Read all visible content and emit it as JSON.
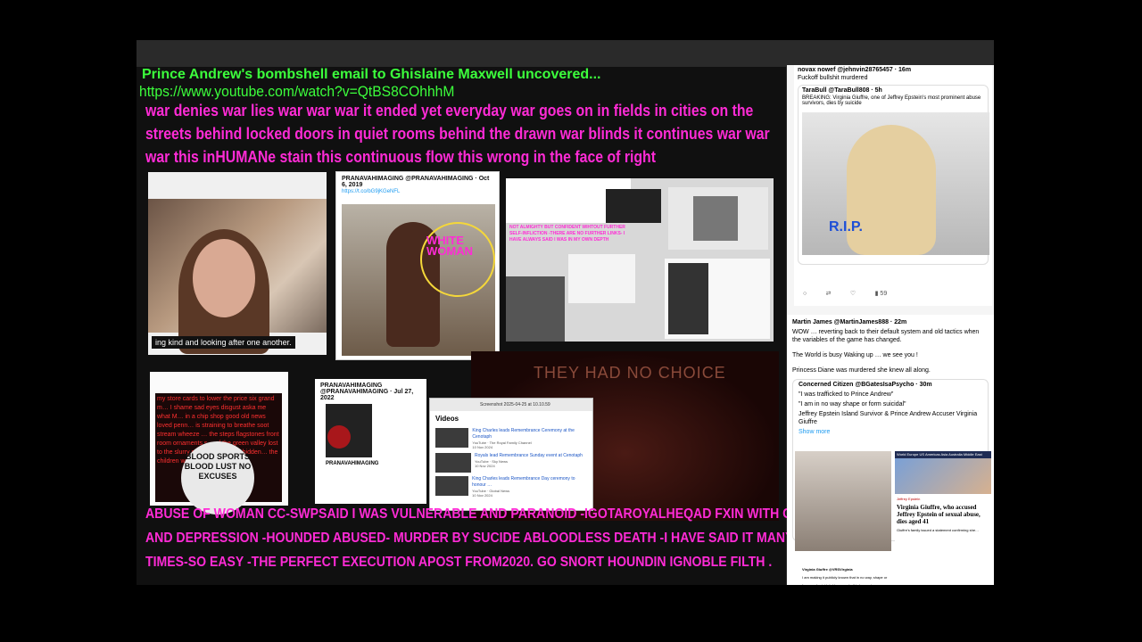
{
  "headline": "Prince Andrew's bombshell email to Ghislaine Maxwell uncovered...",
  "url": "https://www.youtube.com/watch?v=QtBS8COhhhM",
  "poem": "war denies war lies war war war it ended yet everyday war goes on in fields in cities on the streets behind locked doors in quiet rooms behind the drawn war blinds it continues war war war this inHUMANe stain this continuous flow this wrong in the face of right",
  "video_caption": "ing kind and looking after one another.",
  "tweet1": {
    "handle": "PRANAVAHIMAGING @PRANAVAHIMAGING · Oct 6, 2019",
    "link": "https://t.co/bG9jKGeNFL"
  },
  "child_overlay": "WHITE WOMAN",
  "collage2_text": "NOT ALMIGHTY BUT CONFIDENT WIHTOUT FURTHER SELF-INFLICTION -THERE ARE NO FURTHER LINKS- I HAVE ALWAYS SAID I WAS IN MY OWN DEPTH",
  "tweet2": {
    "text": "my store cards to lower the price six grand m… I shame sad eyes disgust aska me what M… in a chip shop good old news loved penn… is straining to breathe soot stream wheeze … the steps flagstones front room ornaments s… of the green valley lost to the slurry slip still … forever hidden… the children woul…"
  },
  "placard": "BLOOD SPORTS BLOOD LUST NO EXCUSES",
  "tweet3": {
    "header": "PRANAVAHIMAGING @PRANAVAHIMAGING · Jul 27, 2022",
    "name": "PRANAVAHIMAGING"
  },
  "window": {
    "title": "Screenshot 2025-04-25 at 10.10.59",
    "heading": "Videos",
    "videos": [
      {
        "title": "King Charles leads Remembrance Ceremony at the Cenotaph",
        "meta": "YouTube · The Royal Family Channel",
        "date": "10 Nov 2024"
      },
      {
        "title": "Royals lead Remembrance Sunday event at Cenotaph",
        "meta": "YouTube · Sky News",
        "date": "10 Nov 2024"
      },
      {
        "title": "King Charles leads Remembrance Day ceremony to honour …",
        "meta": "YouTube · Global News",
        "date": "10 Nov 2024"
      }
    ]
  },
  "dark_text": "THEY HAD NO CHOICE",
  "bottom_text": "ABUSE OF WOMAN CC-SWPSAID I WAS VULNERABLE AND PARANOID -IGOTAROYALHEQAD FXIN WITH CF AND DEPRESSION -HOUNDED ABUSED- MURDER BY SUCIDE ABLOODLESS DEATH -I HAVE SAID IT MANY TIMES-SO EASY -THE PERFECT EXECUTION APOST FROM2020. GO SNORT HOUNDIN IGNOBLE  FILTH .",
  "right_tweet1": {
    "header": "novax nowef @jehnvin28765457 · 16m",
    "body": "Fuckoff bullshit murdered",
    "quote_header": "TaraBull @TaraBull808 · 5h",
    "quote_body": "BREAKING: Virginia Giuffre, one of Jeffrey Epstein's most prominent abuse survivors, dies by suicide",
    "rip": "R.I.P.",
    "views": "59"
  },
  "right_tweet2": {
    "header": "Martin James @MartinJames888 · 22m",
    "p1": "WOW … reverting back to their default system and old tactics when the variables of the game has changed.",
    "p2": "The World is busy Waking up … we see you !",
    "p3": "Princess Diane was murdered she knew all along.",
    "quote_header": "Concerned Citizen @BGatesIsaPsycho · 30m",
    "q1": "\"I was trafficked to Prince Andrew\"",
    "q2": "\"I am in no way shape or form suicidal\"",
    "q3": "Jeffrey Epstein Island Survivor & Prince Andrew Accuser Virginia Giuffre",
    "show_more": "Show more",
    "news_nav": "World  Europe  US  Americas  Asia  Australia  Middle East",
    "news_label": "Jeffrey Epstein",
    "news_headline": "Virginia Giuffre, who accused Jeffrey Epstein of sexual abuse, dies aged 41",
    "news_sub": "Giuffre's family issued a statement confirming she…",
    "vcard_name": "Virginia Giuffre @VRSVirginia",
    "vcard_text": "I am making it publicly known that in no way, shape or form am I suicidal. I have made this known to my therapist and GP- If something…"
  }
}
